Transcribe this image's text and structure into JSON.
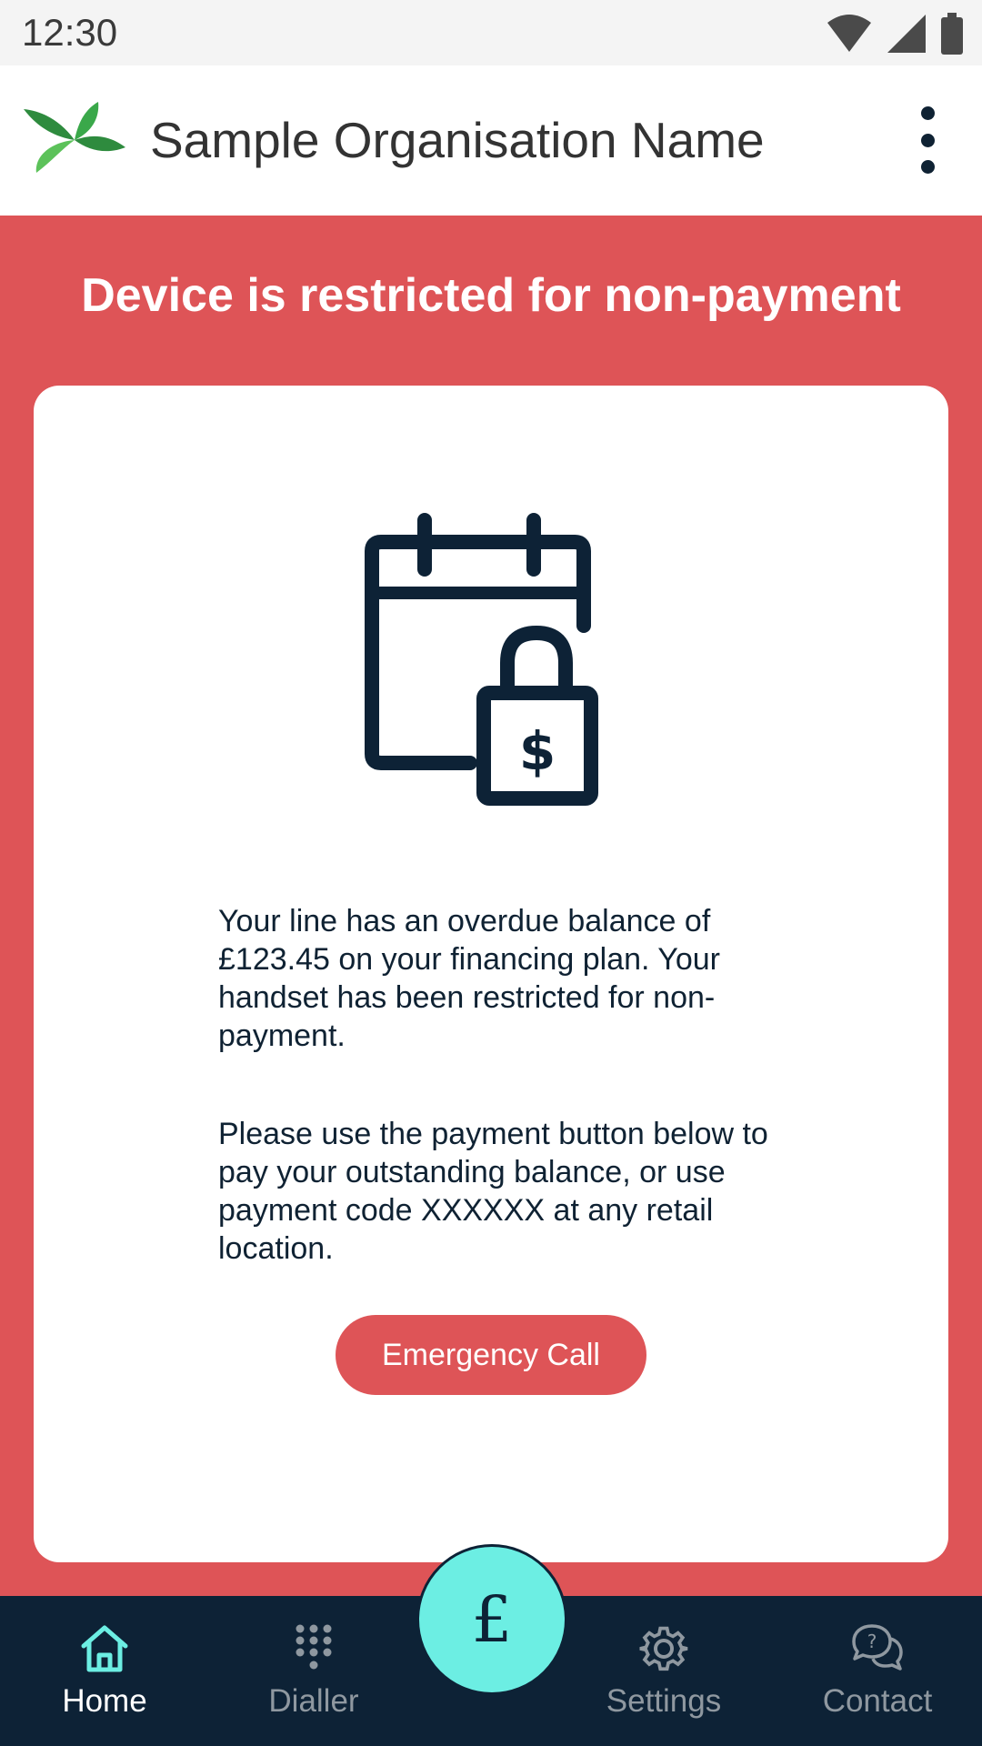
{
  "status_bar": {
    "time": "12:30"
  },
  "app_bar": {
    "org_name": "Sample Organisation Name"
  },
  "banner": {
    "title": "Device is restricted for non-payment"
  },
  "card": {
    "message_1": "Your line has an overdue balance of £123.45 on your  financing plan. Your handset has been restricted for non-payment.",
    "message_2": "Please use the payment button below to pay your outstanding balance, or use payment code XXXXXX at any retail location.",
    "emergency_button": "Emergency Call"
  },
  "bottom_nav": {
    "items": [
      {
        "label": "Home",
        "icon": "home-icon",
        "active": true
      },
      {
        "label": "Dialler",
        "icon": "dialpad-icon",
        "active": false
      },
      {
        "label": "Settings",
        "icon": "gear-icon",
        "active": false
      },
      {
        "label": "Contact",
        "icon": "chat-help-icon",
        "active": false
      }
    ],
    "fab_symbol": "£"
  },
  "colors": {
    "banner_red": "#de5457",
    "navy": "#0d2236",
    "accent_teal": "#6ceee3",
    "logo_green": "#3aa84a"
  }
}
